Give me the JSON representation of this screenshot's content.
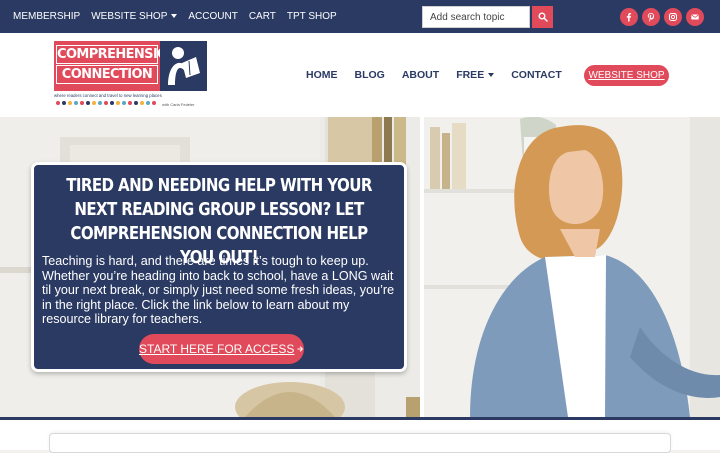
{
  "topbar": {
    "nav": [
      "MEMBERSHIP",
      "WEBSITE SHOP",
      "ACCOUNT",
      "CART",
      "TPT SHOP"
    ],
    "search_placeholder": "Add search topic",
    "social_icons": [
      "facebook-icon",
      "pinterest-icon",
      "instagram-icon",
      "email-icon"
    ]
  },
  "logo": {
    "line1": "COMPREHENSION",
    "line2": "CONNECTION",
    "tagline": "where readers connect and travel to new learning places",
    "signature": "with Carla Fedeler"
  },
  "mainnav": {
    "items": [
      "HOME",
      "BLOG",
      "ABOUT",
      "FREE",
      "CONTACT"
    ],
    "shop_button": "WEBSITE SHOP"
  },
  "hero": {
    "headline": "TIRED AND NEEDING HELP WITH YOUR NEXT READING GROUP LESSON? LET COMPREHENSION CONNECTION HELP YOU OUT!",
    "body": "Teaching is hard, and there are times it’s tough to keep up. Whether you’re heading into back to school, have a LONG wait til your next break, or simply just need some fresh ideas, you’re in the right place. Click the link below to learn about my resource library for teachers.",
    "cta": "START HERE FOR ACCESS"
  },
  "colors": {
    "navy": "#2b3a63",
    "accent": "#e04a5a"
  }
}
